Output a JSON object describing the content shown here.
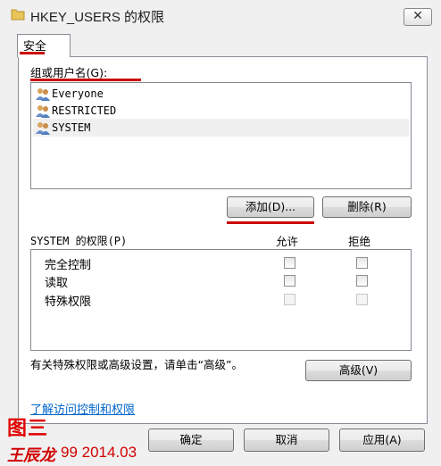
{
  "window": {
    "title": "HKEY_USERS 的权限",
    "close_symbol": "✕"
  },
  "tabs": [
    {
      "label": "安全"
    }
  ],
  "groups": {
    "label": "组或用户名(G):",
    "items": [
      {
        "label": "Everyone",
        "selected": false
      },
      {
        "label": "RESTRICTED",
        "selected": false
      },
      {
        "label": "SYSTEM",
        "selected": true
      }
    ]
  },
  "buttons": {
    "add": "添加(D)...",
    "remove": "删除(R)",
    "advanced": "高级(V)",
    "ok": "确定",
    "cancel": "取消",
    "apply": "应用(A)"
  },
  "permissions": {
    "label": "SYSTEM 的权限(P)",
    "columns": {
      "allow": "允许",
      "deny": "拒绝"
    },
    "rows": [
      {
        "name": "完全控制",
        "allow": false,
        "deny": false,
        "enabled": true
      },
      {
        "name": "读取",
        "allow": false,
        "deny": false,
        "enabled": true
      },
      {
        "name": "特殊权限",
        "allow": false,
        "deny": false,
        "enabled": false
      }
    ]
  },
  "advanced_text": "有关特殊权限或高级设置，请单击“高级”。",
  "help_link": "了解访问控制和权限",
  "annotations": {
    "figure_label": "图三",
    "author": "王辰龙",
    "date": "99 2014.03"
  },
  "colors": {
    "annotation": "#cc0000",
    "link": "#0066cc",
    "selected_row": "#f0f0f0"
  }
}
